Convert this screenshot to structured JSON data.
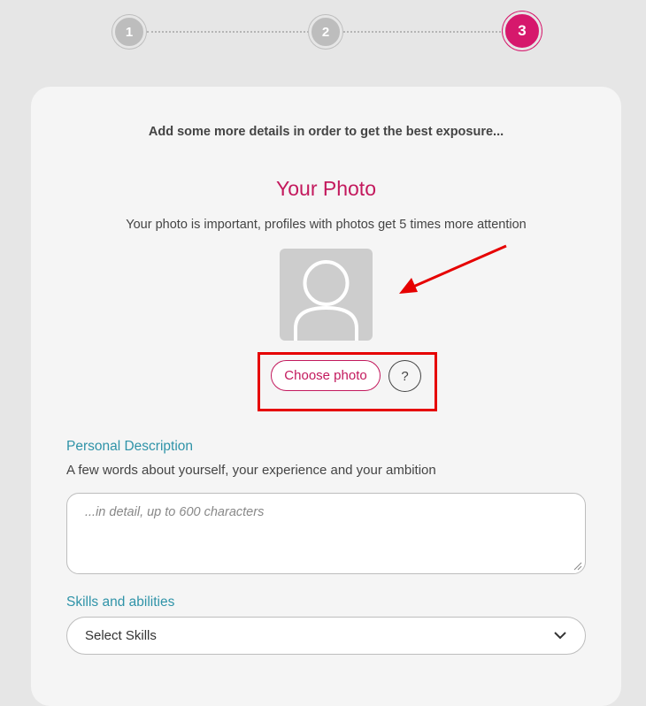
{
  "stepper": {
    "steps": [
      {
        "label": "1",
        "state": "completed"
      },
      {
        "label": "2",
        "state": "completed"
      },
      {
        "label": "3",
        "state": "active"
      }
    ],
    "active_color": "#d6186c",
    "inactive_color": "#bdbdbd"
  },
  "header": {
    "intro": "Add some more details in order to get the best exposure..."
  },
  "photo": {
    "title": "Your Photo",
    "subtitle": "Your photo is important, profiles with photos get 5 times more attention",
    "avatar_icon": "user-silhouette-icon",
    "choose_label": "Choose photo",
    "help_label": "?"
  },
  "annotation": {
    "arrow_icon": "red-arrow-icon",
    "highlight_color": "#e60000"
  },
  "description": {
    "label": "Personal Description",
    "hint": "A few words about yourself, your experience and your ambition",
    "placeholder": "...in detail, up to 600 characters"
  },
  "skills": {
    "label": "Skills and abilities",
    "selected": "Select Skills",
    "chevron_icon": "chevron-down-icon"
  },
  "colors": {
    "brand": "#c3195d",
    "section_label": "#2f93a8",
    "background": "#e6e6e6",
    "card": "#f5f5f5"
  }
}
